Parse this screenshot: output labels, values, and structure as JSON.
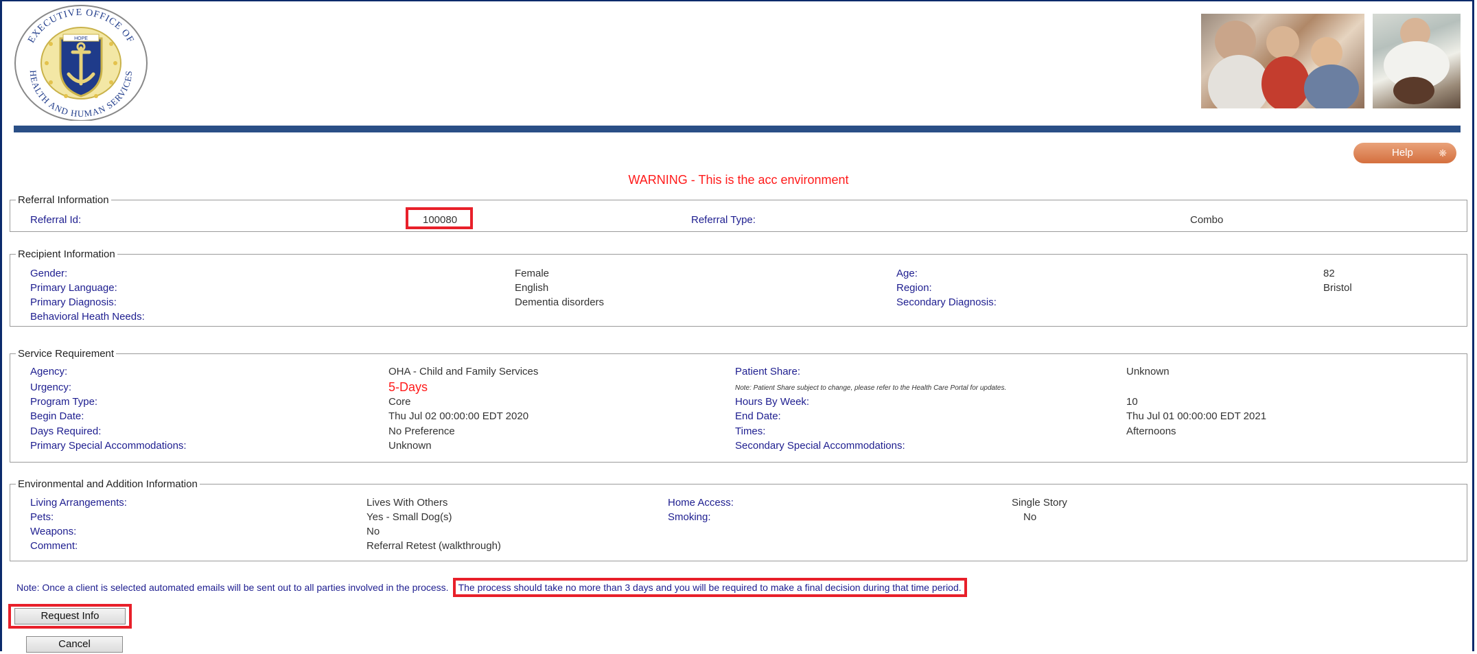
{
  "header": {
    "seal_text_top": "EXECUTIVE OFFICE OF",
    "seal_text_bottom": "HEALTH AND HUMAN SERVICES",
    "seal_banner": "HOPE"
  },
  "help_label": "Help",
  "warning": "WARNING - This is the acc environment",
  "referral": {
    "legend": "Referral Information",
    "id_label": "Referral Id:",
    "id_value": "100080",
    "type_label": "Referral Type:",
    "type_value": "Combo"
  },
  "recipient": {
    "legend": "Recipient Information",
    "gender_label": "Gender:",
    "gender_value": "Female",
    "age_label": "Age:",
    "age_value": "82",
    "language_label": "Primary Language:",
    "language_value": "English",
    "region_label": "Region:",
    "region_value": "Bristol",
    "diagnosis_label": "Primary Diagnosis:",
    "diagnosis_value": "Dementia disorders",
    "secondary_diagnosis_label": "Secondary Diagnosis:",
    "behavioral_label": "Behavioral Heath Needs:"
  },
  "service": {
    "legend": "Service Requirement",
    "agency_label": "Agency:",
    "agency_value": "OHA - Child and Family Services",
    "patient_share_label": "Patient Share:",
    "patient_share_value": "Unknown",
    "urgency_label": "Urgency:",
    "urgency_value": "5-Days",
    "patient_share_note": "Note: Patient Share subject to change, please refer to the Health Care Portal for updates.",
    "program_label": "Program Type:",
    "program_value": "Core",
    "hours_label": "Hours By Week:",
    "hours_value": "10",
    "begin_label": "Begin Date:",
    "begin_value": "Thu Jul 02 00:00:00 EDT 2020",
    "end_label": "End Date:",
    "end_value": "Thu Jul 01 00:00:00 EDT 2021",
    "days_label": "Days Required:",
    "days_value": "No Preference",
    "times_label": "Times:",
    "times_value": "Afternoons",
    "primary_acc_label": "Primary Special Accommodations:",
    "primary_acc_value": "Unknown",
    "secondary_acc_label": "Secondary Special Accommodations:"
  },
  "environment": {
    "legend": "Environmental and Addition Information",
    "living_label": "Living Arrangements:",
    "living_value": "Lives With Others",
    "home_access_label": "Home Access:",
    "home_access_value": "Single Story",
    "pets_label": "Pets:",
    "pets_value": "Yes - Small Dog(s)",
    "smoking_label": "Smoking:",
    "smoking_value": "No",
    "weapons_label": "Weapons:",
    "weapons_value": "No",
    "comment_label": "Comment:",
    "comment_value": "Referral Retest (walkthrough)"
  },
  "note": {
    "prefix": "Note: Once a client is selected automated emails will be sent out to all parties involved in the process.",
    "highlight": "The process should take no more than 3 days and you will be required to make a final decision during that time period."
  },
  "buttons": {
    "request_info": "Request Info",
    "cancel": "Cancel"
  },
  "colors": {
    "label_blue": "#1d1d8f",
    "warning_red": "#ff1a1a",
    "highlight_red": "#e8202a",
    "bar_blue": "#2a4f86",
    "help_orange": "#d46f3e"
  }
}
